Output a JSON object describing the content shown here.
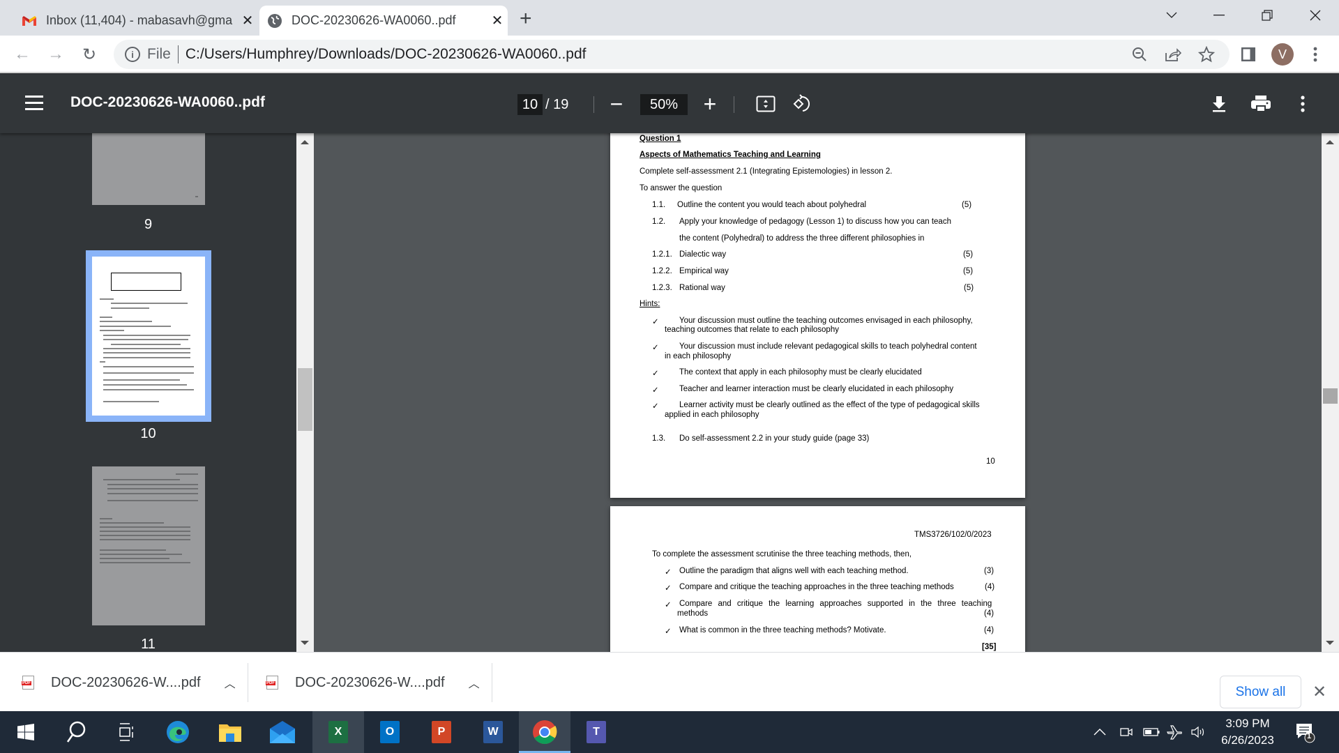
{
  "browser": {
    "tabs": [
      {
        "title": "Inbox (11,404) - mabasavh@gma",
        "icon": "gmail-icon",
        "active": false
      },
      {
        "title": "DOC-20230626-WA0060..pdf",
        "icon": "globe-icon",
        "active": true
      }
    ],
    "new_tab_label": "+",
    "address_bar": {
      "scheme_label": "File",
      "url": "C:/Users/Humphrey/Downloads/DOC-20230626-WA0060..pdf"
    },
    "profile_initial": "V"
  },
  "pdf_viewer": {
    "file_name": "DOC-20230626-WA0060..pdf",
    "current_page": "10",
    "total_pages": "/ 19",
    "zoom_level": "50%",
    "zoom_out_label": "−",
    "zoom_in_label": "+"
  },
  "sidebar": {
    "thumbnails": [
      {
        "page_label": "9",
        "selected": false
      },
      {
        "page_label": "10",
        "selected": true
      },
      {
        "page_label": "11",
        "selected": false
      }
    ]
  },
  "document": {
    "page10": {
      "question_heading": "Question 1",
      "section_title": "Aspects of Mathematics Teaching and Learning",
      "intro": "Complete self-assessment 2.1 (Integrating Epistemologies) in lesson 2.",
      "lead_in": "To answer the question",
      "items": [
        {
          "num": "1.1.",
          "text": "Outline the content you would teach about polyhedral",
          "marks": "(5)"
        },
        {
          "num": "1.2.",
          "text": "Apply your knowledge of pedagogy (Lesson 1) to discuss how you can teach",
          "marks": ""
        },
        {
          "num": "",
          "text": "the content (Polyhedral) to address the three different philosophies in",
          "marks": ""
        },
        {
          "num": "1.2.1.",
          "text": "Dialectic way",
          "marks": "(5)"
        },
        {
          "num": "1.2.2.",
          "text": "Empirical way",
          "marks": "(5)"
        },
        {
          "num": "1.2.3.",
          "text": "Rational way",
          "marks": "(5)"
        }
      ],
      "hints_heading": "Hints:",
      "hints": [
        {
          "line1": "Your discussion must outline the teaching outcomes envisaged in each philosophy,",
          "line2": "teaching outcomes that relate to each philosophy"
        },
        {
          "line1": "Your discussion must include relevant pedagogical skills to teach polyhedral content",
          "line2": "in each philosophy"
        },
        {
          "line1": "The context that apply in each philosophy must be clearly elucidated",
          "line2": ""
        },
        {
          "line1": "Teacher and learner interaction must be clearly elucidated in each philosophy",
          "line2": ""
        },
        {
          "line1": "Learner activity must be clearly outlined as the effect of the type of pedagogical skills",
          "line2": "applied in each philosophy"
        }
      ],
      "check_mark": "✓",
      "item_13_num": "1.3.",
      "item_13_text": "Do self-assessment 2.2 in your study guide (page 33)",
      "page_number": "10"
    },
    "page11": {
      "header_code": "TMS3726/102/0/2023",
      "lead_in": "To complete the assessment scrutinise the three teaching methods, then,",
      "items": [
        {
          "line1": "Outline the paradigm that aligns well with each teaching method.",
          "line2": "",
          "marks": "(3)"
        },
        {
          "line1": "Compare and critique the teaching approaches in the three teaching methods",
          "line2": "",
          "marks": "(4)"
        },
        {
          "line1": "Compare and critique the learning approaches supported in the three teaching",
          "line2": "methods",
          "marks": "(4)"
        },
        {
          "line1": "What is common in the three teaching methods? Motivate.",
          "line2": "",
          "marks": "(4)"
        }
      ],
      "total_marks": "[35]"
    }
  },
  "downloads": {
    "items": [
      {
        "name": "DOC-20230626-W....pdf"
      },
      {
        "name": "DOC-20230626-W....pdf"
      }
    ],
    "show_all_label": "Show all",
    "close_label": "✕"
  },
  "taskbar": {
    "apps": [
      "start",
      "search",
      "task-view",
      "edge",
      "file-explorer",
      "mail",
      "excel",
      "outlook",
      "powerpoint",
      "word",
      "chrome",
      "teams"
    ],
    "time": "3:09 PM",
    "date": "6/26/2023",
    "notification_count": "1",
    "colors": {
      "excel": "#1d6f42",
      "outlook": "#0072c6",
      "powerpoint": "#d24726",
      "word": "#2b579a",
      "teams": "#5558af"
    }
  }
}
